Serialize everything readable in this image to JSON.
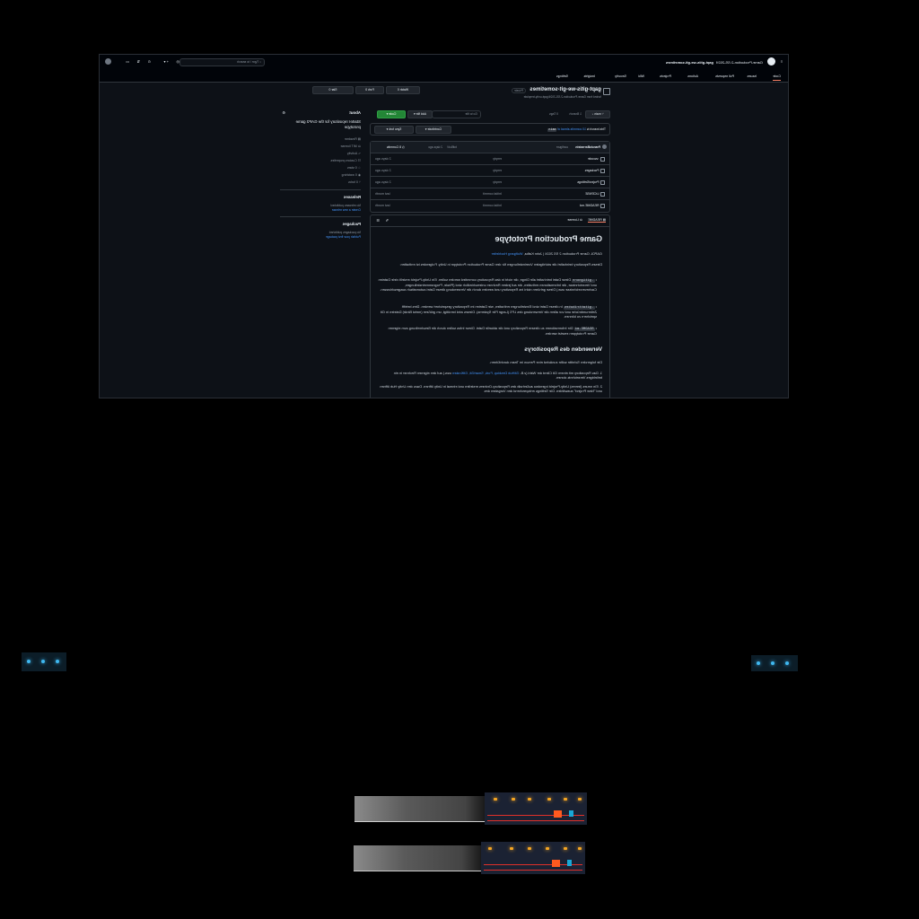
{
  "header": {
    "repo_path": "gapt-gitis-we-git-sometimes",
    "org_name": "Game-Production-2-SS-2024",
    "search_placeholder": "Type / to search"
  },
  "tabs": [
    {
      "label": "Code"
    },
    {
      "label": "Issues"
    },
    {
      "label": "Pull requests"
    },
    {
      "label": "Actions"
    },
    {
      "label": "Projects"
    },
    {
      "label": "Wiki"
    },
    {
      "label": "Security"
    },
    {
      "label": "Insights"
    },
    {
      "label": "Settings"
    }
  ],
  "repo": {
    "name": "gapt-gitis-we-git-sometimes",
    "visibility": "Private",
    "forked_from": "forked from Game-Production-2-SS-2024/gapt-unity-template",
    "watch_label": "Watch",
    "watch_count": "0",
    "fork_label": "Fork",
    "fork_count": "0",
    "star_label": "Star",
    "star_count": "0"
  },
  "toolbar": {
    "branch": "main",
    "branches": "1 Branch",
    "tags": "0 Tags",
    "goto_file": "Go to file",
    "add_file": "Add file",
    "code": "Code"
  },
  "sync": {
    "message_prefix": "This branch is",
    "message_link": "10 commits ahead of",
    "message_suffix": "main",
    "contribute": "Contribute",
    "sync_fork": "Sync fork"
  },
  "commit": {
    "author": "FrancisBernstein",
    "badge": "configure",
    "hash": "bdf5c4f",
    "time": "2 days ago",
    "count": "8 Commits"
  },
  "files": [
    {
      "name": ".vscode",
      "msg": "empty",
      "date": "2 days ago"
    },
    {
      "name": "Packages",
      "msg": "empty",
      "date": "2 days ago"
    },
    {
      "name": "ProjectSettings",
      "msg": "empty",
      "date": "2 days ago"
    },
    {
      "name": "LICENSE",
      "msg": "Initial commit",
      "date": "last month"
    },
    {
      "name": "README.md",
      "msg": "Initial commit",
      "date": "last month"
    }
  ],
  "readme_tabs": {
    "readme": "README",
    "license": "License"
  },
  "readme": {
    "title": "Game Production Prototype",
    "byline_prefix": "GAPDL Game Production 2 SS 2024 | John Kafka,",
    "byline_link": "Wolfgang Hochleiter",
    "intro": "Dieses Repository beinhaltet die wichtigsten Voreinstellungen für den Game Production Prototype in Unity. Folgendes ist enthalten:",
    "bullets": [
      {
        "code": ".gitignore",
        "text": "Diese Datei beinhaltet alle Dinge, die nicht in das Repository commited werden sollen. Ein Unity-Projekt erstellt viele Dateien und Verzeichnisse, die Informationen enthalten, die auf jedem Rechner unterschiedlich sind (Pfade, Programmeinstellungen, Cacheverzeichnisse usw.) Diese gehören nicht ins Repository und werden durch die Verwendung dieser Datei automatisch ausgeschlossen."
      },
      {
        "code": ".gitattributes",
        "text": "In dieser Datei sind Einstellungen enthalten, wie Dateien im Repository gespeichert werden. Dies betrifft Zeilenumbrüche und vor allem die Verwendung des LFS (Large File Systems). Dieses wird benötigt, um größere (meist Binär) Dateien in Git speichern zu können."
      },
      {
        "code": "README.md",
        "text": "Die Informationen zu diesem Repository und die aktuelle Datei. Diese Infos sollen durch die Beschreibung zum eigenen Game Prototypen ersetzt werden."
      }
    ],
    "section_title": "Verwenden des Repositorys",
    "section_intro": "Die folgenden Schritte sollte zunächst eine Person im Team durchführen.",
    "step1_prefix": "1. Das Repository mit einem Git Client der Wahl (z.B.",
    "step1_links": "GitHub Desktop, Fork, SmartGit, GitKraken",
    "step1_suffix": "usw.) auf den eigenen Rechner in ein beliebiges Verzeichnis clonen.",
    "step2": "2. Ein neues (leeres) Unity-Projekt irgendwo außerhalb des Repository-Ordners erstellen und einmal in Unity öffnen. Dazu den Unity Hub öffnen und \"New Project\" auswählen. Die Settings entsprechend den Vorgaben des"
  },
  "about": {
    "heading": "About",
    "description": "Starter repository for the GAP2 game prototype",
    "items": [
      {
        "icon": "book-icon",
        "label": "Readme"
      },
      {
        "icon": "scale-icon",
        "label": "MIT license"
      },
      {
        "icon": "pulse-icon",
        "label": "Activity"
      },
      {
        "icon": "sliders-icon",
        "label": "Custom properties"
      },
      {
        "icon": "star-icon",
        "label": "0 stars"
      },
      {
        "icon": "eye-icon",
        "label": "0 watching"
      },
      {
        "icon": "fork-icon",
        "label": "0 forks"
      }
    ]
  },
  "releases": {
    "heading": "Releases",
    "text": "No releases published",
    "link": "Create a new release"
  },
  "packages": {
    "heading": "Packages",
    "text": "No packages published",
    "link": "Publish your first package"
  },
  "colors": {
    "page_bg": "#0d1117",
    "accent_green": "#238636",
    "link_blue": "#4493f8",
    "tab_underline": "#f78166"
  }
}
